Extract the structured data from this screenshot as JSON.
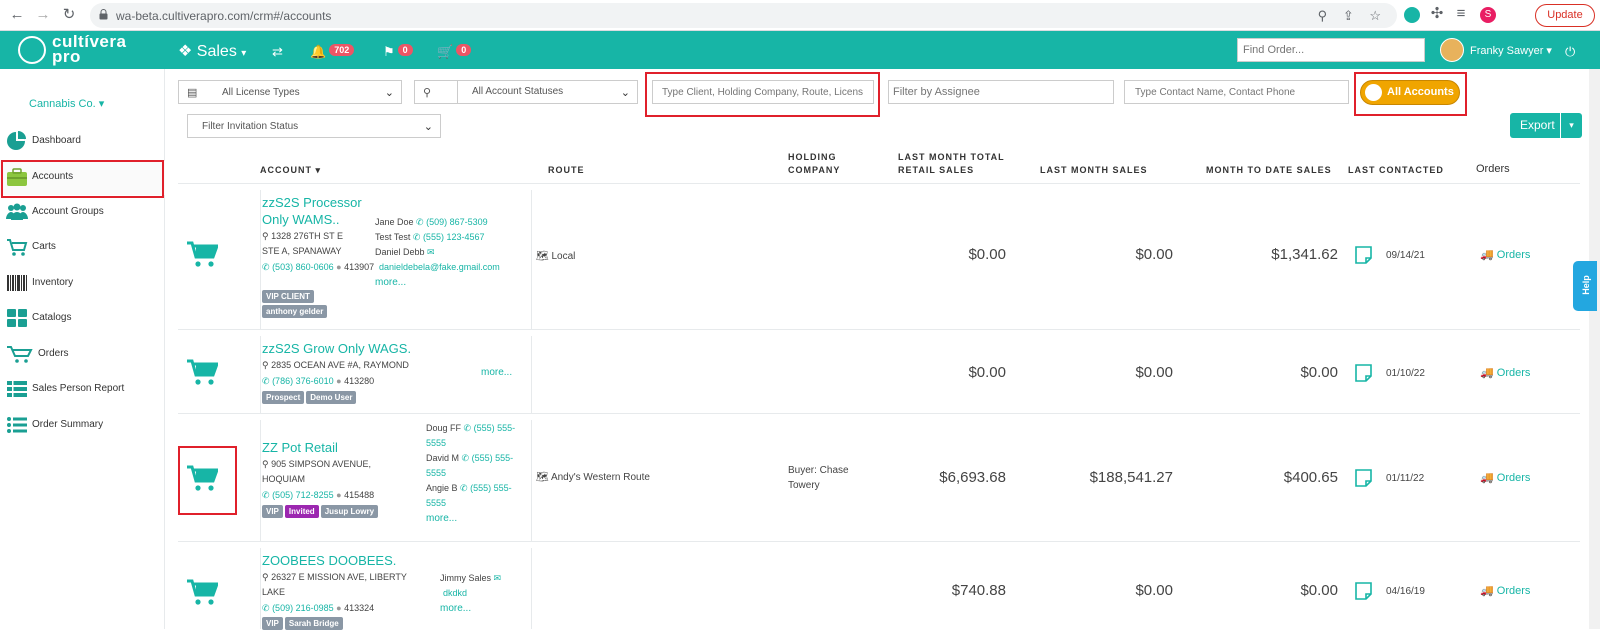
{
  "browser": {
    "url": "wa-beta.cultiverapro.com/crm#/accounts",
    "update_label": "Update",
    "profile_initial": "S"
  },
  "header": {
    "logo_line1": "cultívera",
    "logo_line2": "pro",
    "module": "Sales",
    "notifications_count": "702",
    "flags_count": "0",
    "cart_count": "0",
    "find_order_placeholder": "Find Order...",
    "user_name": "Franky Sawyer"
  },
  "sidebar": {
    "company": "Cannabis Co.",
    "items": [
      {
        "label": "Dashboard",
        "icon": "pie-chart-icon"
      },
      {
        "label": "Accounts",
        "icon": "briefcase-icon"
      },
      {
        "label": "Account Groups",
        "icon": "users-icon"
      },
      {
        "label": "Carts",
        "icon": "cart-icon"
      },
      {
        "label": "Inventory",
        "icon": "barcode-icon"
      },
      {
        "label": "Catalogs",
        "icon": "grid-icon"
      },
      {
        "label": "Orders",
        "icon": "shopping-cart-icon"
      },
      {
        "label": "Sales Person Report",
        "icon": "table-icon"
      },
      {
        "label": "Order Summary",
        "icon": "list-icon"
      }
    ]
  },
  "filters": {
    "license_types": "All License Types",
    "account_statuses": "All Account Statuses",
    "client_search_placeholder": "Type Client, Holding Company, Route, Licens",
    "assignee_placeholder": "Filter by Assignee",
    "contact_placeholder": "Type Contact Name, Contact Phone",
    "all_accounts_toggle": "All Accounts",
    "invitation_status": "Filter Invitation Status",
    "export_label": "Export"
  },
  "table": {
    "headers": {
      "account": "ACCOUNT ▾",
      "route": "ROUTE",
      "holding_line1": "HOLDING",
      "holding_line2": "COMPANY",
      "last_month_retail_line1": "LAST MONTH TOTAL",
      "last_month_retail_line2": "RETAIL SALES",
      "last_month_sales": "LAST MONTH SALES",
      "month_to_date": "MONTH TO DATE SALES",
      "last_contacted": "LAST CONTACTED",
      "orders": "Orders"
    },
    "rows": [
      {
        "name_line1": "zzS2S Processor",
        "name_line2": "Only WAMS..",
        "addr_line1": "1328 276TH ST E",
        "addr_line2": "STE A, SPANAWAY",
        "phone": "(503) 860-0606",
        "license": "413907",
        "tags": [
          "VIP CLIENT",
          "anthony gelder"
        ],
        "contacts": [
          {
            "name": "Jane Doe",
            "phone": "(509) 867-5309"
          },
          {
            "name": "Test Test",
            "phone": "(555) 123-4567"
          },
          {
            "name": "Daniel Debb",
            "phone": ""
          }
        ],
        "email": "danieldebela@fake.gmail.com",
        "more": "more...",
        "route": "Local",
        "holding_line1": "",
        "holding_line2": "",
        "last_month_retail": "$0.00",
        "last_month_sales": "$0.00",
        "month_to_date": "$1,341.62",
        "last_contacted": "09/14/21",
        "orders": "Orders"
      },
      {
        "name_line1": "zzS2S Grow Only WAGS.",
        "addr_line1": "2835 OCEAN AVE #A, RAYMOND",
        "phone": "(786) 376-6010",
        "license": "413280",
        "tags": [
          "Prospect",
          "Demo User"
        ],
        "more": "more...",
        "route": "",
        "last_month_retail": "$0.00",
        "last_month_sales": "$0.00",
        "month_to_date": "$0.00",
        "last_contacted": "01/10/22",
        "orders": "Orders"
      },
      {
        "name_line1": "ZZ Pot Retail",
        "addr_line1": "905 SIMPSON AVENUE,",
        "addr_line2": "HOQUIAM",
        "phone": "(505) 712-8255",
        "license": "415488",
        "tags": [
          "VIP",
          "Invited",
          "Jusup Lowry"
        ],
        "contacts": [
          {
            "name": "Doug FF",
            "phone_a": "(555) 555-",
            "phone_b": "5555"
          },
          {
            "name": "David M",
            "phone_a": "(555) 555-",
            "phone_b": "5555"
          },
          {
            "name": "Angie B",
            "phone_a": "(555) 555-",
            "phone_b": "5555"
          }
        ],
        "more": "more...",
        "route": "Andy's Western Route",
        "holding_line1": "Buyer: Chase",
        "holding_line2": "Towery",
        "last_month_retail": "$6,693.68",
        "last_month_sales": "$188,541.27",
        "month_to_date": "$400.65",
        "last_contacted": "01/11/22",
        "orders": "Orders"
      },
      {
        "name_line1": "ZOOBEES DOOBEES.",
        "addr_line1": "26327 E MISSION AVE, LIBERTY",
        "addr_line2": "LAKE",
        "phone": "(509) 216-0985",
        "license": "413324",
        "tags": [
          "VIP",
          "Sarah Bridge"
        ],
        "contacts": [
          {
            "name": "Jimmy Sales",
            "phone": ""
          }
        ],
        "email": "dkdkd",
        "more": "more...",
        "route": "",
        "last_month_retail": "$740.88",
        "last_month_sales": "$0.00",
        "month_to_date": "$0.00",
        "last_contacted": "04/16/19",
        "orders": "Orders"
      }
    ]
  },
  "help_label": "Help",
  "colors": {
    "brand_teal": "#17b5a6",
    "toggle_orange": "#f0a500",
    "highlight_red": "#e0202b",
    "badge_red": "#ed5565"
  }
}
